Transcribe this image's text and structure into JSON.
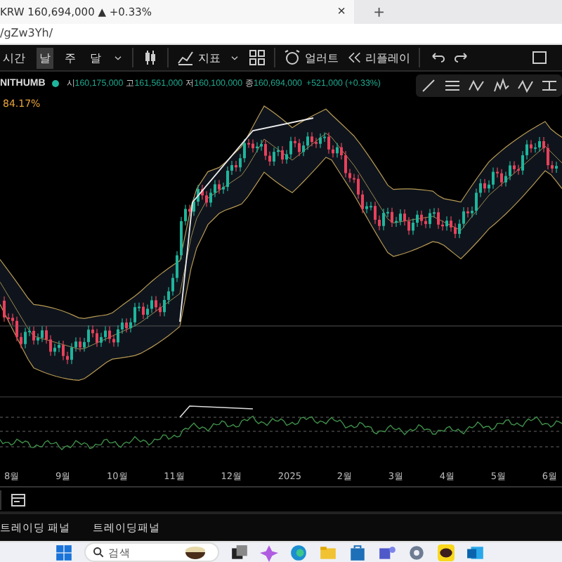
{
  "browser": {
    "tab": {
      "title": "KRW 160,694,000 ▲ +0.33%",
      "close": "×"
    },
    "new_tab": "+",
    "url": "/gZw3Yh/"
  },
  "toolbar": {
    "intervals": [
      {
        "label": "시간",
        "selected": false
      },
      {
        "label": "날",
        "selected": true
      },
      {
        "label": "주",
        "selected": false
      },
      {
        "label": "달",
        "selected": false
      }
    ],
    "indicators": "지표",
    "alert": "얼러트",
    "replay": "리플레이"
  },
  "legend": {
    "symbol": "NITHUMB",
    "values": [
      {
        "key": "시",
        "value": "160,175,000"
      },
      {
        "key": "고",
        "value": "161,561,000"
      },
      {
        "key": "저",
        "value": "160,100,000"
      },
      {
        "key": "종",
        "value": "160,694,000"
      }
    ],
    "change": "+521,000 (+0.33%)"
  },
  "chart": {
    "percent_label": "84.17%"
  },
  "time_axis": [
    "8월",
    "9월",
    "10월",
    "11월",
    "12월",
    "2025",
    "2월",
    "3월",
    "4월",
    "5월",
    "6월"
  ],
  "panel_tabs": [
    {
      "label": "트레이딩 패널"
    },
    {
      "label": "트레이딩패널"
    }
  ],
  "taskbar": {
    "search": {
      "placeholder": "검색"
    }
  }
}
